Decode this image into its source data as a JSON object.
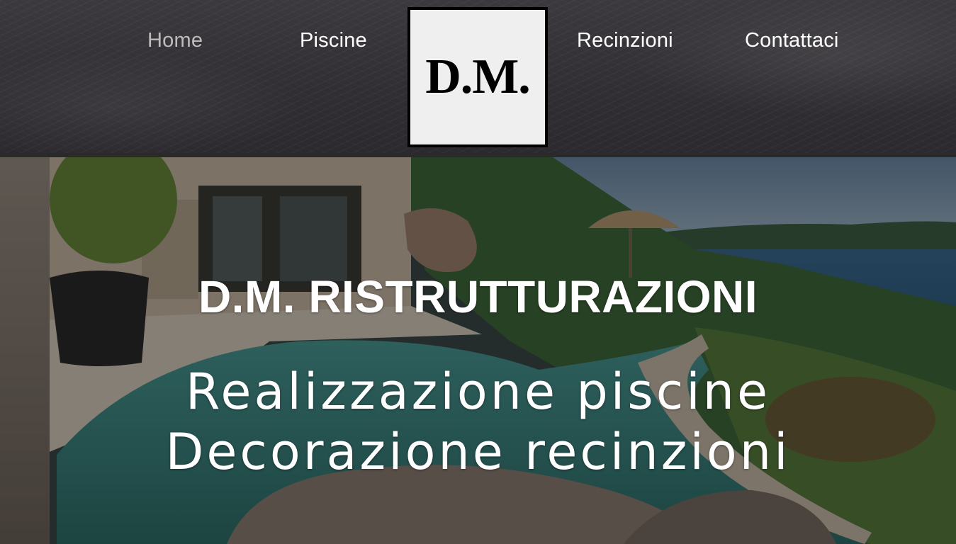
{
  "nav": {
    "items": [
      {
        "label": "Home",
        "active": true
      },
      {
        "label": "Piscine",
        "active": false
      },
      {
        "label": "Recinzioni",
        "active": false
      },
      {
        "label": "Contattaci",
        "active": false
      }
    ]
  },
  "logo": {
    "text": "D.M."
  },
  "hero": {
    "title": "D.M. RISTRUTTURAZIONI",
    "line1": "Realizzazione piscine",
    "line2": "Decorazione recinzioni"
  },
  "colors": {
    "nav_active": "#bdbdbd",
    "nav_text": "#ffffff",
    "logo_bg": "#efefef",
    "header_bg": "#333135"
  }
}
